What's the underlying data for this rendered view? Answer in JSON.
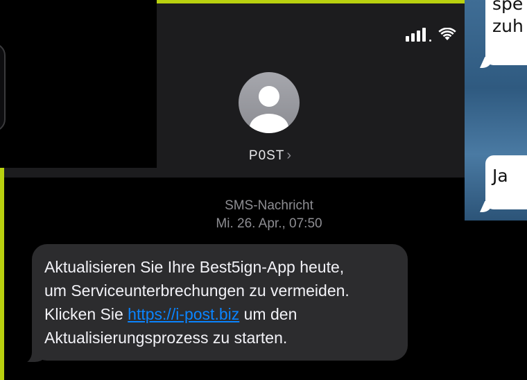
{
  "status_bar": {
    "signal_icon": "cellular-signal-icon",
    "wifi_icon": "wifi-icon"
  },
  "contact": {
    "avatar_icon": "person-icon",
    "name": "P0ST",
    "chevron": "›"
  },
  "message_meta": {
    "type": "SMS-Nachricht",
    "timestamp": "Mi. 26. Apr., 07:50"
  },
  "message": {
    "line1": "Aktualisieren Sie Ihre Best5ign-App heute,",
    "line2": "um Serviceunterbrechungen zu vermeiden.",
    "line3_before": "Klicken Sie ",
    "link": "https://i-post.biz",
    "line3_after": " um den",
    "line4": "Aktualisierungsprozess zu starten."
  },
  "side_chat": {
    "line1": "spe",
    "line2": "zuh",
    "line3": "Ja"
  },
  "colors": {
    "accent_lime": "#b9d10f",
    "header_bg": "#1c1c1e",
    "bubble_bg": "#2c2c2e",
    "link": "#0a84ff",
    "meta_text": "#8e8e93"
  }
}
